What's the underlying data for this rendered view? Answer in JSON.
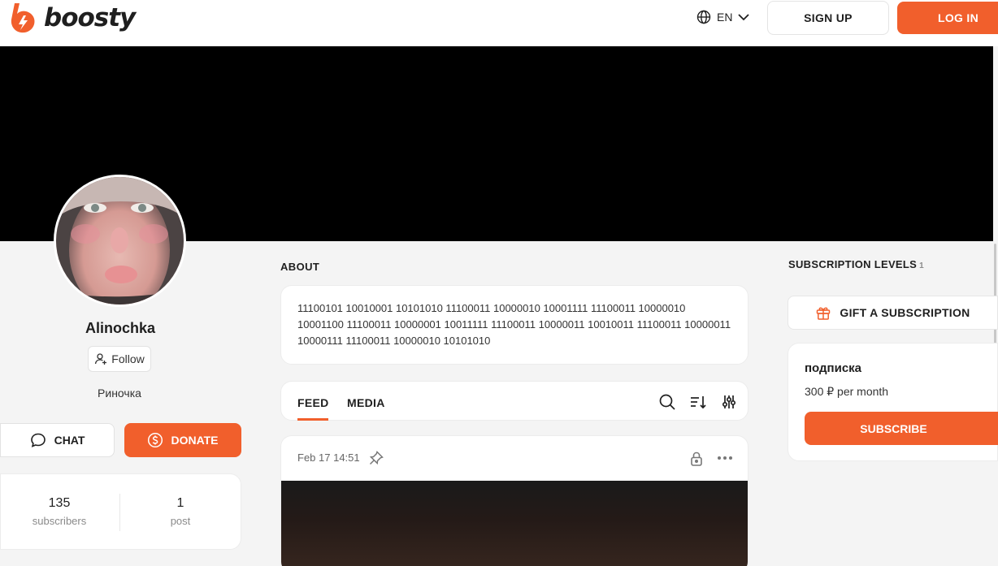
{
  "brand": {
    "name": "boosty",
    "accent": "#f15f2c"
  },
  "header": {
    "language": "EN",
    "signup_label": "SIGN UP",
    "login_label": "LOG IN"
  },
  "profile": {
    "name": "Alinochka",
    "follow_label": "Follow",
    "bio": "Риночка",
    "chat_label": "CHAT",
    "donate_label": "DONATE",
    "stats": {
      "subscribers_count": "135",
      "subscribers_label": "subscribers",
      "posts_count": "1",
      "posts_label": "post"
    }
  },
  "about": {
    "title": "ABOUT",
    "text": "11100101 10010001 10101010 11100011 10000010 10001111 11100011 10000010 10001100 11100011 10000001 10011111 11100011 10000011 10010011 11100011 10000011 10000111 11100011 10000010 10101010"
  },
  "feed": {
    "tabs": [
      "FEED",
      "MEDIA"
    ],
    "active_tab": "FEED",
    "icons": [
      "search-icon",
      "sort-icon",
      "filter-icon"
    ]
  },
  "post": {
    "date": "Feb 17 14:51",
    "icons": [
      "pin-icon",
      "lock-icon",
      "more-icon"
    ]
  },
  "subscriptions": {
    "title": "SUBSCRIPTION LEVELS",
    "count": "1",
    "gift_label": "GIFT A SUBSCRIPTION",
    "levels": [
      {
        "name": "подписка",
        "price": "300 ₽ per month",
        "button": "SUBSCRIBE"
      }
    ]
  }
}
